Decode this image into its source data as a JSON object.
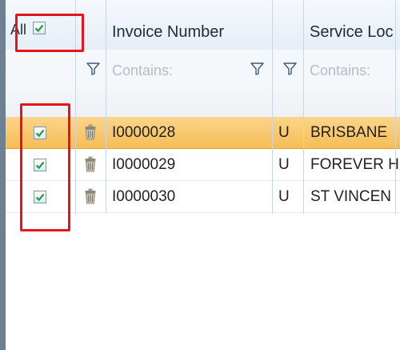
{
  "header": {
    "all_label": "All",
    "invoice_number_label": "Invoice Number",
    "service_location_label": "Service Loc"
  },
  "filters": {
    "invoice_placeholder": "Contains:",
    "service_placeholder": "Contains:"
  },
  "rows": [
    {
      "checked": true,
      "invoice": "I0000028",
      "status": "U",
      "service_location": "BRISBANE",
      "selected": true
    },
    {
      "checked": true,
      "invoice": "I0000029",
      "status": "U",
      "service_location": "FOREVER H",
      "selected": false
    },
    {
      "checked": true,
      "invoice": "I0000030",
      "status": "U",
      "service_location": "ST VINCEN",
      "selected": false
    }
  ],
  "icons": {
    "filter": "filter-funnel-icon",
    "delete": "trash-icon",
    "check": "checkmark-icon"
  },
  "colors": {
    "selected_row": "#f6bd56",
    "checkbox_tick": "#1f9d47",
    "callout": "#e8141b",
    "header_text": "#1d2b3a"
  }
}
